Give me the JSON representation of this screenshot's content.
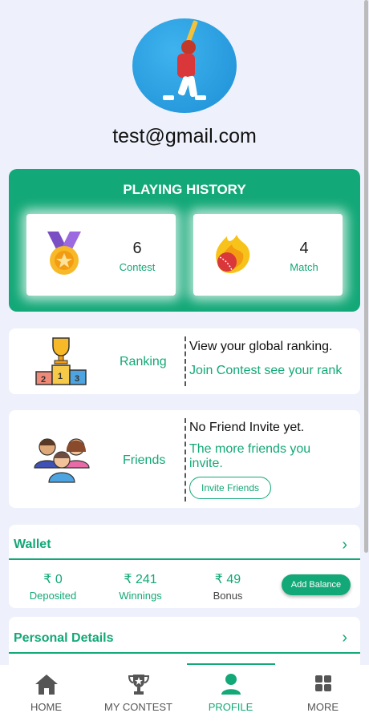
{
  "profile": {
    "email": "test@gmail.com"
  },
  "history": {
    "title": "PLAYING HISTORY",
    "contest": {
      "count": "6",
      "label": "Contest"
    },
    "match": {
      "count": "4",
      "label": "Match"
    }
  },
  "ranking": {
    "title": "Ranking",
    "line1": "View your global ranking.",
    "line2": "Join Contest see your rank"
  },
  "friends": {
    "title": "Friends",
    "line1": "No Friend Invite yet.",
    "line2": "The more friends you",
    "line3": "invite.",
    "button": "Invite Friends"
  },
  "wallet": {
    "title": "Wallet",
    "deposited": {
      "value": "₹ 0",
      "label": "Deposited"
    },
    "winnings": {
      "value": "₹ 241",
      "label": "Winnings"
    },
    "bonus": {
      "value": "₹ 49",
      "label": "Bonus"
    },
    "add_balance": "Add Balance"
  },
  "personal": {
    "title": "Personal Details"
  },
  "nav": {
    "home": "HOME",
    "my_contest": "MY CONTEST",
    "profile": "PROFILE",
    "more": "MORE",
    "active": "profile"
  },
  "colors": {
    "accent": "#13a877",
    "background": "#eef1fb"
  }
}
